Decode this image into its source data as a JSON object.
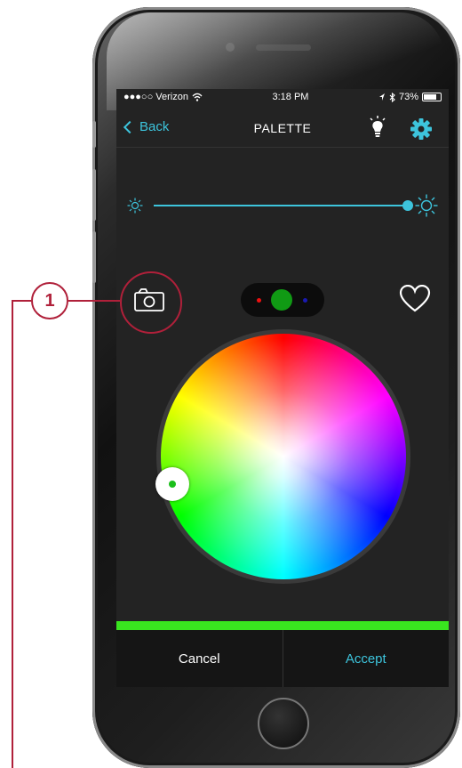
{
  "statusbar": {
    "carrier": "●●●○○ Verizon",
    "time": "3:18 PM",
    "battery": "73%"
  },
  "navbar": {
    "back_label": "Back",
    "title": "PALETTE",
    "icons": [
      "lightbulb-icon",
      "gear-icon"
    ]
  },
  "brightness": {
    "level": 0.98
  },
  "selected_color": {
    "hex": "#39e51f",
    "rgb_indicator": [
      "red",
      "green",
      "blue"
    ]
  },
  "actions": {
    "cancel_label": "Cancel",
    "accept_label": "Accept"
  },
  "callout": {
    "number": "1",
    "target": "camera-icon"
  },
  "colors": {
    "accent": "#3dc4dc",
    "background": "#232323",
    "callout": "#b0203a"
  }
}
